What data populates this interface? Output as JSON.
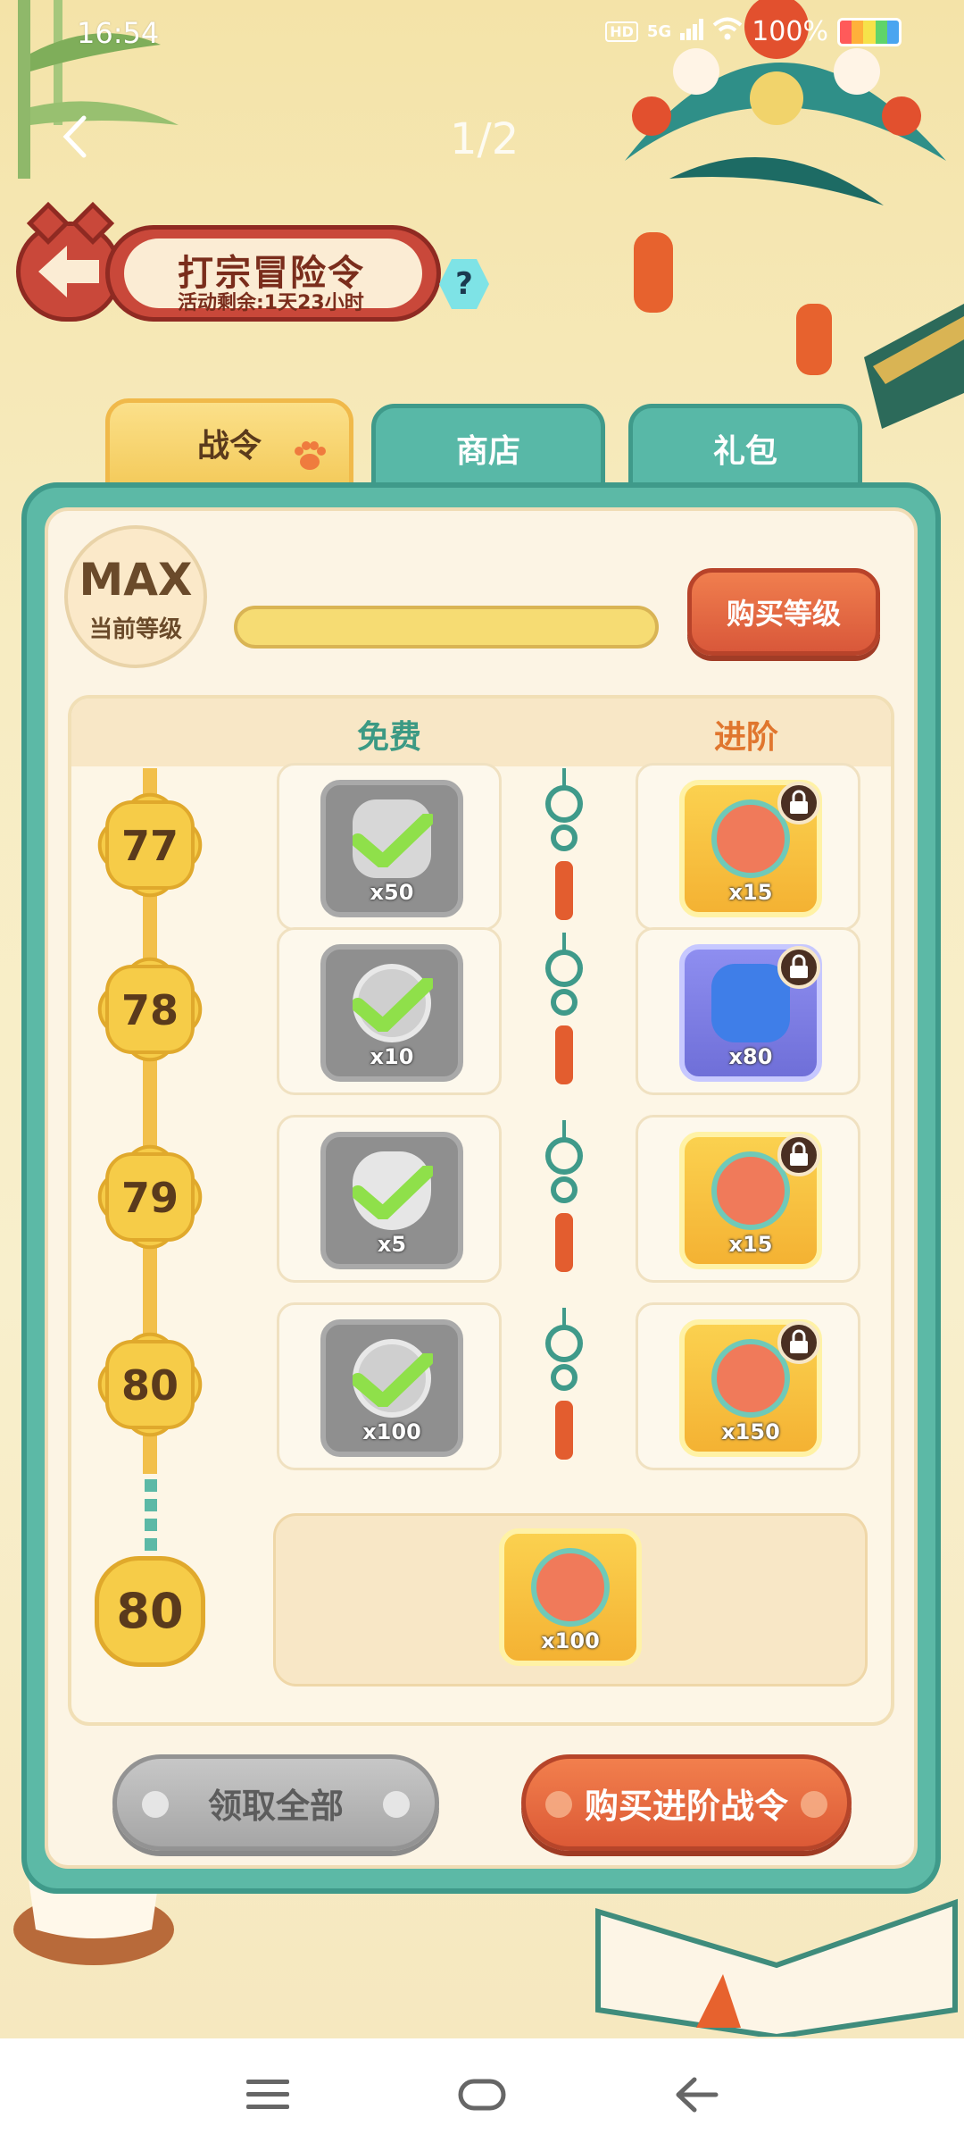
{
  "status_bar": {
    "time": "16:54",
    "hd": "HD",
    "network": "5G",
    "battery": "100%"
  },
  "nav": {
    "page_indicator": "1/2"
  },
  "header": {
    "title": "打宗冒险令",
    "subtitle": "活动剩余:1天23小时",
    "help_label": "?"
  },
  "tabs": [
    {
      "label": "战令",
      "active": true
    },
    {
      "label": "商店",
      "active": false
    },
    {
      "label": "礼包",
      "active": false
    }
  ],
  "level": {
    "value": "MAX",
    "caption": "当前等级",
    "buy_button": "购买等级"
  },
  "columns": {
    "free": "免费",
    "advanced": "进阶"
  },
  "rows": [
    {
      "level": "77",
      "free_count": "x50",
      "adv_count": "x15"
    },
    {
      "level": "78",
      "free_count": "x10",
      "adv_count": "x80"
    },
    {
      "level": "79",
      "free_count": "x5",
      "adv_count": "x15"
    },
    {
      "level": "80",
      "free_count": "x100",
      "adv_count": "x150"
    }
  ],
  "final_reward": {
    "level": "80",
    "count": "x100"
  },
  "buttons": {
    "claim_all": "领取全部",
    "buy_advanced": "购买进阶战令"
  },
  "colors": {
    "panel_teal": "#5cb9a6",
    "accent_orange": "#dc5a36",
    "gold": "#f6cc48"
  }
}
